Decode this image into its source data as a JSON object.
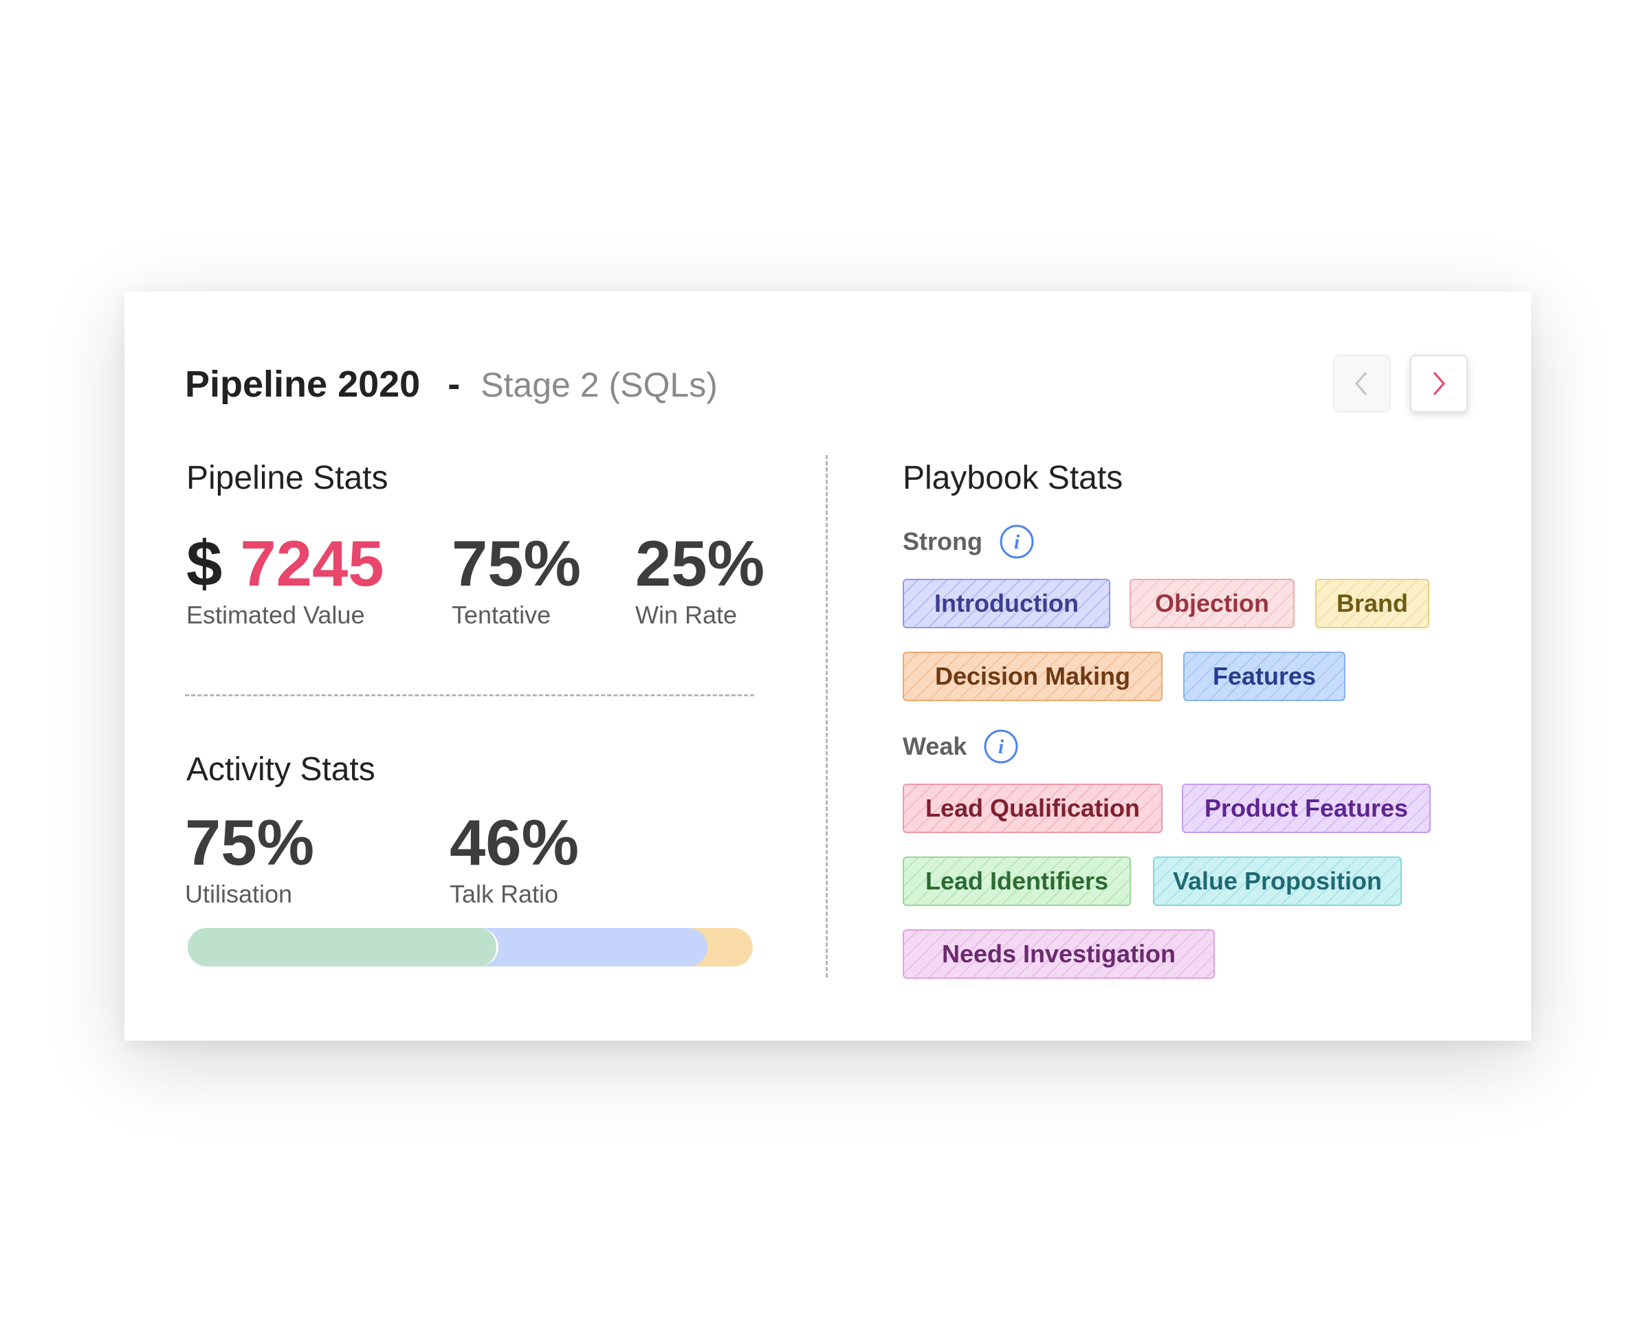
{
  "header": {
    "title": "Pipeline 2020",
    "dash": "-",
    "subtitle": "Stage 2 (SQLs)"
  },
  "nav": {
    "prev_icon": "chevron-left-icon",
    "next_icon": "chevron-right-icon",
    "accent": "#e8466b"
  },
  "pipeline_stats": {
    "title": "Pipeline Stats",
    "estimated_value": {
      "currency": "$",
      "value": "7245",
      "label": "Estimated Value"
    },
    "tentative": {
      "value": "75%",
      "label": "Tentative"
    },
    "win_rate": {
      "value": "25%",
      "label": "Win Rate"
    }
  },
  "activity_stats": {
    "title": "Activity Stats",
    "utilisation": {
      "value": "75%",
      "label": "Utilisation"
    },
    "talk_ratio": {
      "value": "46%",
      "label": "Talk Ratio"
    },
    "bar_segments": [
      {
        "name": "green",
        "fraction": 0.55,
        "color": "#bde1cc"
      },
      {
        "name": "blue",
        "fraction": 0.37,
        "color": "#c4d4fb"
      },
      {
        "name": "yellow",
        "fraction": 0.08,
        "color": "#f9dba7"
      }
    ]
  },
  "playbook_stats": {
    "title": "Playbook Stats",
    "strong": {
      "label": "Strong",
      "icon": "info-icon",
      "tags": [
        {
          "label": "Introduction",
          "bg": "#d9dcfb",
          "border": "#8e98ee",
          "text": "#3a3f8f"
        },
        {
          "label": "Objection",
          "bg": "#fbe1e3",
          "border": "#f3a9b1",
          "text": "#9a3540"
        },
        {
          "label": "Brand",
          "bg": "#fcf0c8",
          "border": "#e6cf84",
          "text": "#6f5a14"
        },
        {
          "label": "Decision Making",
          "bg": "#fbd9bf",
          "border": "#eba86c",
          "text": "#6d3a14"
        },
        {
          "label": "Features",
          "bg": "#c7dcfc",
          "border": "#86b1ef",
          "text": "#263c8c"
        }
      ]
    },
    "weak": {
      "label": "Weak",
      "icon": "info-icon",
      "tags": [
        {
          "label": "Lead Qualification",
          "bg": "#fbd6dc",
          "border": "#ee98a6",
          "text": "#7f2030"
        },
        {
          "label": "Product Features",
          "bg": "#ead9fb",
          "border": "#c59bf0",
          "text": "#5d2590"
        },
        {
          "label": "Lead Identifiers",
          "bg": "#d6f5d6",
          "border": "#98d898",
          "text": "#2c6a34"
        },
        {
          "label": "Value Proposition",
          "bg": "#cbf1f3",
          "border": "#84d7df",
          "text": "#1f6a72"
        },
        {
          "label": "Needs Investigation",
          "bg": "#f4d9f4",
          "border": "#dea2de",
          "text": "#6a2a6e"
        }
      ]
    }
  }
}
